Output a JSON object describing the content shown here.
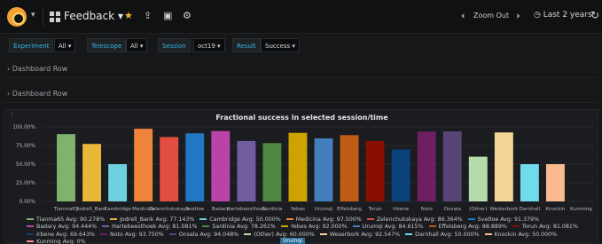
{
  "navbar": {
    "dashboard_title": "Feedback",
    "zoom_out_label": "Zoom Out",
    "time_range_label": "Last 2 years"
  },
  "variables": [
    {
      "label": "Experiment",
      "value": "All"
    },
    {
      "label": "Telescope",
      "value": "All"
    },
    {
      "label": "Session",
      "value": "oct19"
    },
    {
      "label": "Result",
      "value": "Success"
    }
  ],
  "rows": [
    {
      "label": "Dashboard Row"
    },
    {
      "label": "Dashboard Row"
    }
  ],
  "panel": {
    "title": "Fractional success in selected session/time"
  },
  "chart_data": {
    "type": "bar",
    "title": "Fractional success in selected session/time",
    "categories": [
      "Tianma65",
      "Jodrell_Bank",
      "Cambridge",
      "Medicina",
      "Zelenchukskaya",
      "Svetloe",
      "Badary",
      "Hartebeesthoek",
      "Sardinia",
      "Yebes",
      "Urumqi",
      "Effelsberg",
      "Torun",
      "Irbene",
      "Noto",
      "Onsala",
      "(Other)",
      "Westerbork",
      "Darnhall",
      "Knockin",
      "Kunming"
    ],
    "tick_labels": [
      "Tianma65",
      "Jodrell_Bank",
      "Cambridge",
      "Medicina",
      "Zelenchukskaya",
      "Svetloe",
      "Badary",
      "Hartebeesthoek",
      "Sardinia",
      "Yebes",
      "Urumqi",
      "Effelsberg",
      "Torun",
      "Irbene",
      "Noto",
      "Onsala",
      "(Other)",
      "Westerbork",
      "Darnhall",
      "Knockin",
      "Kunming"
    ],
    "values": [
      90.278,
      77.143,
      50.0,
      97.5,
      86.364,
      91.379,
      94.444,
      81.081,
      78.261,
      92.0,
      84.615,
      88.889,
      81.081,
      69.643,
      93.75,
      94.048,
      60.0,
      92.547,
      50.0,
      50.0,
      0
    ],
    "colors": [
      "#7eb26d",
      "#eab839",
      "#6ed0e0",
      "#ef843c",
      "#e24d42",
      "#1f78c1",
      "#ba43a9",
      "#705da0",
      "#508642",
      "#cca300",
      "#447ebc",
      "#c15c17",
      "#890f02",
      "#0a437c",
      "#6d1f62",
      "#584477",
      "#b7dbab",
      "#f4d598",
      "#70dbed",
      "#f9ba8f",
      "#f29191"
    ],
    "yticks": [
      "100.00%",
      "75.00%",
      "50.00%",
      "25.00%",
      "0.00%"
    ],
    "ylim": [
      0,
      100
    ],
    "grid": true,
    "legend": [
      "Tianma65  Avg: 90.278%",
      "Jodrell_Bank  Avg: 77.143%",
      "Cambridge  Avg: 50.000%",
      "Medicina  Avg: 97.500%",
      "Zelenchukskaya  Avg: 86.364%",
      "Svetloe  Avg: 91.379%",
      "Badary  Avg: 94.444%",
      "Hartebeesthoek  Avg: 81.081%",
      "Sardinia  Avg: 78.261%",
      "Yebes  Avg: 92.000%",
      "Urumqi  Avg: 84.615%",
      "Effelsberg  Avg: 88.889%",
      "Torun  Avg: 81.081%",
      "Irbene  Avg: 69.643%",
      "Noto  Avg: 93.750%",
      "Onsala  Avg: 94.048%",
      "(Other)  Avg: 60.000%",
      "Weserbork  Avg: 92.547%",
      "Darnhall  Avg: 50.000%",
      "Knockin  Avg: 50.000%",
      "Kunming  Avg: 0%"
    ],
    "tooltip_label": "Urumqi"
  }
}
